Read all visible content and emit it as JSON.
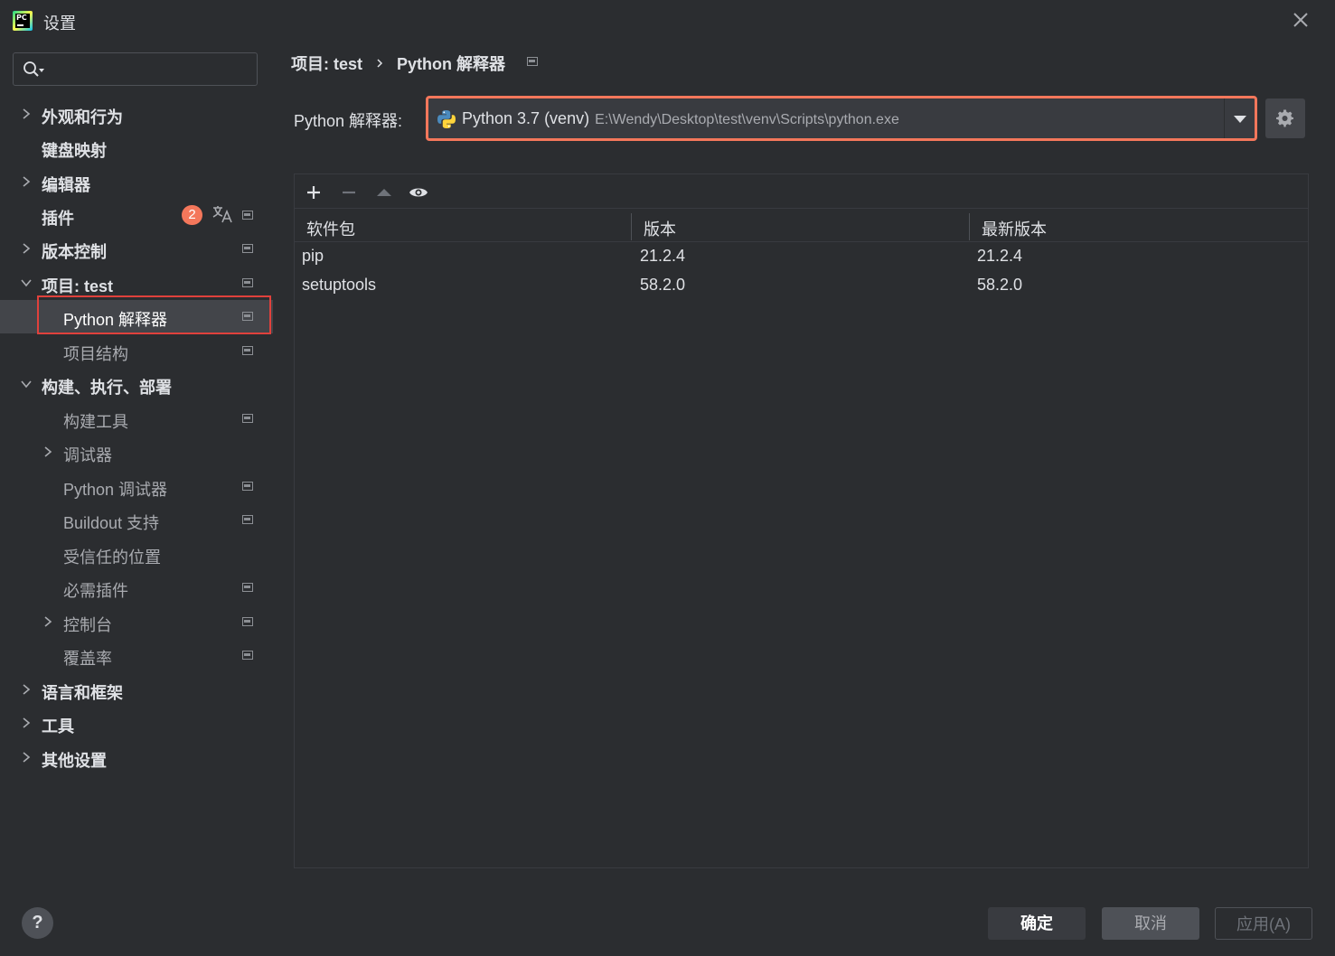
{
  "window": {
    "title": "设置"
  },
  "search": {
    "placeholder": ""
  },
  "sidebar": {
    "items": [
      {
        "label": "外观和行为"
      },
      {
        "label": "键盘映射"
      },
      {
        "label": "编辑器"
      },
      {
        "label": "插件",
        "badge": "2"
      },
      {
        "label": "版本控制"
      },
      {
        "label": "项目: test"
      },
      {
        "label": "Python 解释器"
      },
      {
        "label": "项目结构"
      },
      {
        "label": "构建、执行、部署"
      },
      {
        "label": "构建工具"
      },
      {
        "label": "调试器"
      },
      {
        "label": "Python 调试器"
      },
      {
        "label": "Buildout 支持"
      },
      {
        "label": "受信任的位置"
      },
      {
        "label": "必需插件"
      },
      {
        "label": "控制台"
      },
      {
        "label": "覆盖率"
      },
      {
        "label": "语言和框架"
      },
      {
        "label": "工具"
      },
      {
        "label": "其他设置"
      }
    ],
    "help": "?"
  },
  "breadcrumb": {
    "project": "项目: test",
    "page": "Python 解释器"
  },
  "interpreter": {
    "label": "Python 解释器:",
    "name": "Python 3.7 (venv)",
    "path": "E:\\Wendy\\Desktop\\test\\venv\\Scripts\\python.exe"
  },
  "packages": {
    "columns": [
      "软件包",
      "版本",
      "最新版本"
    ],
    "rows": [
      [
        "pip",
        "21.2.4",
        "21.2.4"
      ],
      [
        "setuptools",
        "58.2.0",
        "58.2.0"
      ]
    ]
  },
  "footer": {
    "ok": "确定",
    "cancel": "取消",
    "apply": "应用(A)"
  },
  "colors": {
    "background": "#2b2d30",
    "accent_outline": "#e0413c",
    "badge": "#f4775b"
  }
}
